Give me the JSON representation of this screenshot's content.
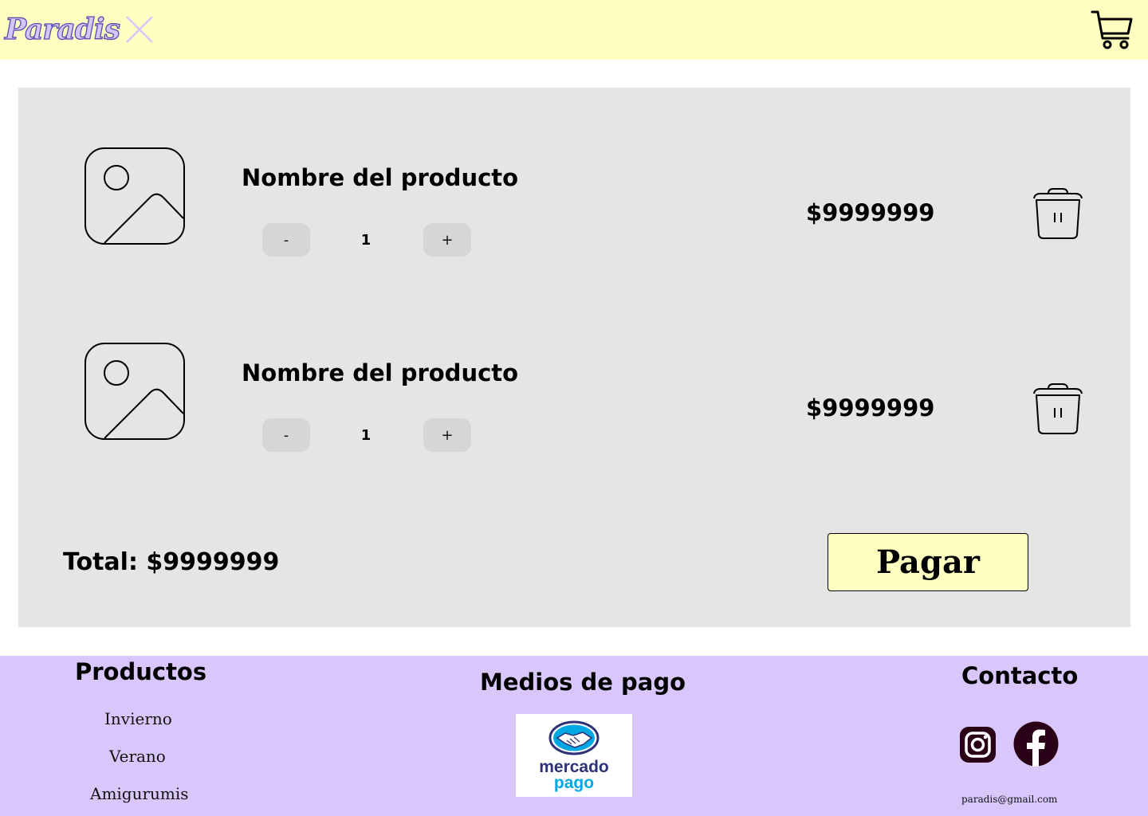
{
  "header": {
    "logo_text": "Paradis",
    "colors": {
      "background": "#FFFFC2",
      "logo_fill": "#D5C6FA"
    }
  },
  "cart": {
    "items": [
      {
        "name": "Nombre del producto",
        "quantity": "1",
        "decrement_label": "-",
        "increment_label": "+",
        "price": "$9999999"
      },
      {
        "name": "Nombre del producto",
        "quantity": "1",
        "decrement_label": "-",
        "increment_label": "+",
        "price": "$9999999"
      }
    ],
    "total_label": "Total: $9999999",
    "pay_label": "Pagar",
    "colors": {
      "panel": "#E5E5E5",
      "qty_button": "#D6D6D6",
      "pay_button": "#FFFFC2"
    }
  },
  "footer": {
    "products_heading": "Productos",
    "product_links": [
      "Invierno",
      "Verano",
      "Amigurumis"
    ],
    "payments_heading": "Medios de pago",
    "payment_logo_text": [
      "mercado",
      "pago"
    ],
    "contact_heading": "Contacto",
    "email": "paradis@gmail.com",
    "social_icons": [
      "instagram-icon",
      "facebook-icon"
    ],
    "colors": {
      "background": "#D9C7FC",
      "social": "#2A0017",
      "mp_navy": "#2D3277",
      "mp_blue": "#00A8E3"
    }
  }
}
